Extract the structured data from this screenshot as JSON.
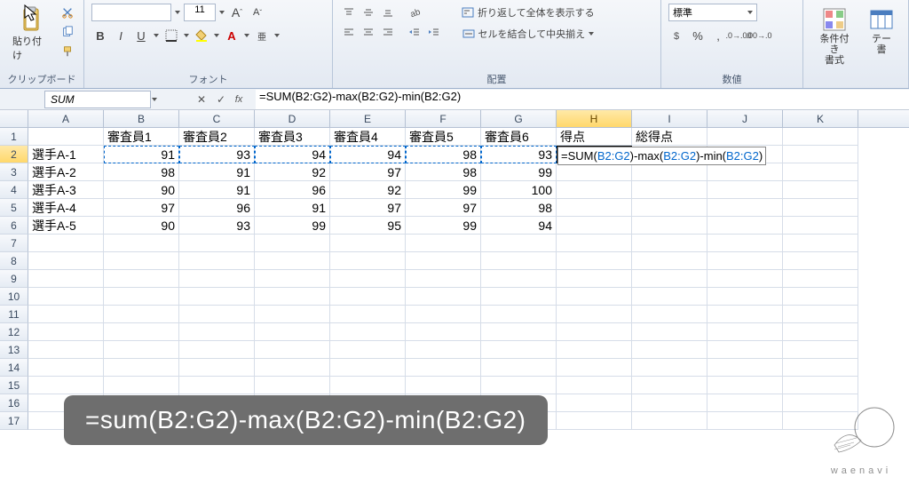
{
  "ribbon": {
    "clipboard": {
      "title": "クリップボード",
      "paste": "貼り付け"
    },
    "font": {
      "title": "フォント",
      "size": "11"
    },
    "align": {
      "title": "配置",
      "wrap": "折り返して全体を表示する",
      "merge": "セルを結合して中央揃え"
    },
    "number": {
      "title": "数値",
      "format": "標準"
    },
    "styles": {
      "cond": "条件付き\n書式",
      "table": "テー\n書"
    }
  },
  "namebox": "SUM",
  "formula": "=SUM(B2:G2)-max(B2:G2)-min(B2:G2)",
  "columns": [
    "A",
    "B",
    "C",
    "D",
    "E",
    "F",
    "G",
    "H",
    "I",
    "J",
    "K"
  ],
  "headers": {
    "b1": "審査員1",
    "c1": "審査員2",
    "d1": "審査員3",
    "e1": "審査員4",
    "f1": "審査員5",
    "g1": "審査員6",
    "h1": "得点",
    "i1": "総得点"
  },
  "rows": [
    {
      "a": "選手A-1",
      "b": 91,
      "c": 93,
      "d": 94,
      "e": 94,
      "f": 98,
      "g": 93
    },
    {
      "a": "選手A-2",
      "b": 98,
      "c": 91,
      "d": 92,
      "e": 97,
      "f": 98,
      "g": 99
    },
    {
      "a": "選手A-3",
      "b": 90,
      "c": 91,
      "d": 96,
      "e": 92,
      "f": 99,
      "g": 100
    },
    {
      "a": "選手A-4",
      "b": 97,
      "c": 96,
      "d": 91,
      "e": 97,
      "f": 97,
      "g": 98
    },
    {
      "a": "選手A-5",
      "b": 90,
      "c": 93,
      "d": 99,
      "e": 95,
      "f": 99,
      "g": 94
    }
  ],
  "editing_formula_parts": {
    "pre": "=SUM(",
    "r1": "B2:G2",
    "mid1": ")-max(",
    "r2": "B2:G2",
    "mid2": ")-min(",
    "r3": "B2:G2",
    "post": ")"
  },
  "caption": "=sum(B2:G2)-max(B2:G2)-min(B2:G2)",
  "watermark": "waenavi"
}
